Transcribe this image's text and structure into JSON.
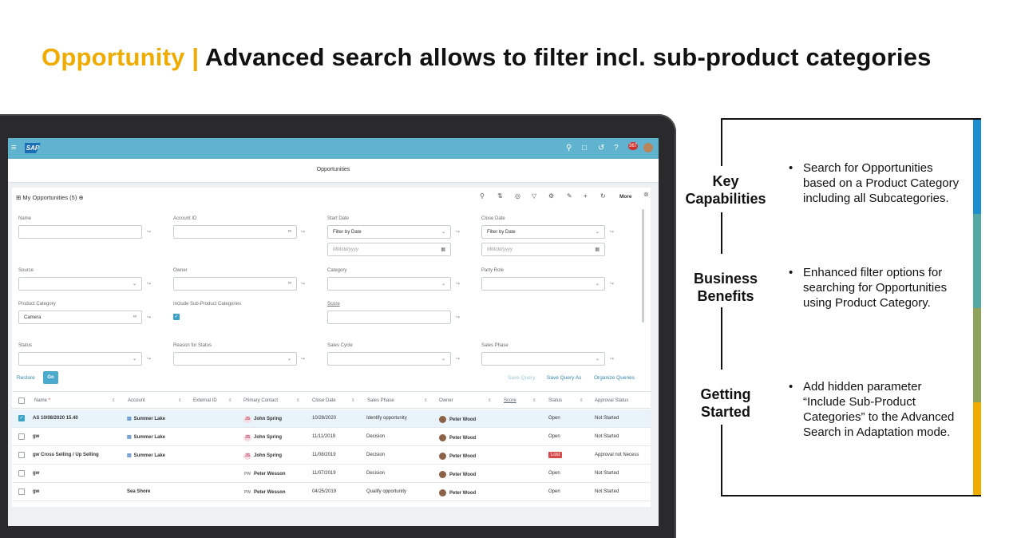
{
  "slide": {
    "title_accent": "Opportunity |",
    "title_rest": "Advanced search allows to filter incl. sub-product categories"
  },
  "shell": {
    "logo": "SAP",
    "menu_icon": "hamburger-icon",
    "notification_count": "367"
  },
  "page": {
    "title": "Opportunities",
    "list_title": "My Opportunities (5)",
    "more_label": "More"
  },
  "filters": {
    "name_label": "Name",
    "account_id_label": "Account ID",
    "start_date_label": "Start Date",
    "start_date_value": "Filter by Date",
    "start_date_placeholder": "MM/dd/yyyy",
    "close_date_label": "Close Date",
    "close_date_value": "Filter by Date",
    "close_date_placeholder": "MM/dd/yyyy",
    "source_label": "Source",
    "owner_label": "Owner",
    "category_label": "Category",
    "party_role_label": "Party Role",
    "product_category_label": "Product Category",
    "product_category_value": "Camera",
    "include_sub_label": "Include Sub-Product Categories",
    "include_sub_checked": true,
    "score_label": "Score",
    "status_label": "Status",
    "reason_label": "Reason for Status",
    "sales_cycle_label": "Sales Cycle",
    "sales_phase_label": "Sales Phase",
    "restore_label": "Restore",
    "go_label": "Go",
    "save_query_label": "Save Query",
    "save_query_as_label": "Save Query As",
    "organize_queries_label": "Organize Queries"
  },
  "table": {
    "headers": {
      "name": "Name",
      "account": "Account",
      "external_id": "External ID",
      "primary_contact": "Primary Contact",
      "close_date": "Close Date",
      "sales_phase": "Sales Phase",
      "owner": "Owner",
      "score": "Score",
      "status": "Status",
      "approval_status": "Approval Status"
    },
    "rows": [
      {
        "name": "AS 10/08/2020 15.40",
        "account": "Summer Lake",
        "contact_initials": "JS",
        "contact": "John Spring",
        "close_date": "10/28/2020",
        "sales_phase": "Identify opportunity",
        "owner": "Peter Wood",
        "status": "Open",
        "approval": "Not Started"
      },
      {
        "name": "gw",
        "account": "Summer Lake",
        "contact_initials": "JS",
        "contact": "John Spring",
        "close_date": "11/11/2019",
        "sales_phase": "Decision",
        "owner": "Peter Wood",
        "status": "Open",
        "approval": "Not Started"
      },
      {
        "name": "gw Cross Selling / Up Selling",
        "account": "Summer Lake",
        "contact_initials": "JS",
        "contact": "John Spring",
        "close_date": "11/08/2019",
        "sales_phase": "Decision",
        "owner": "Peter Wood",
        "status": "Lost",
        "approval": "Approval not Necess"
      },
      {
        "name": "gw",
        "account": "",
        "contact_initials": "PW",
        "contact": "Peter Wesson",
        "close_date": "11/07/2019",
        "sales_phase": "Decision",
        "owner": "Peter Wood",
        "status": "Open",
        "approval": "Not Started"
      },
      {
        "name": "gw",
        "account": "Sea Shore",
        "contact_initials": "PW",
        "contact": "Peter Wesson",
        "close_date": "04/25/2019",
        "sales_phase": "Qualify opportunity",
        "owner": "Peter Wood",
        "status": "Open",
        "approval": "Not Started"
      }
    ]
  },
  "panel": {
    "sections": [
      {
        "caption": "Key Capabilities",
        "bullet": "Search for Opportunities based on a Product Category including all Subcategories."
      },
      {
        "caption": "Business Benefits",
        "bullet": "Enhanced filter options for searching for Opportunities using Product Category."
      },
      {
        "caption": "Getting Started",
        "bullet": "Add hidden parameter “Include Sub-Product Categories” to the Advanced Search in Adaptation mode."
      }
    ],
    "stripe_colors": [
      "#1b8fd0",
      "#55a7a1",
      "#8ea35b",
      "#f0ab00"
    ]
  },
  "colors": {
    "accent": "#f0ab00",
    "shell": "#5fb3cf",
    "link": "#2f86b0"
  }
}
